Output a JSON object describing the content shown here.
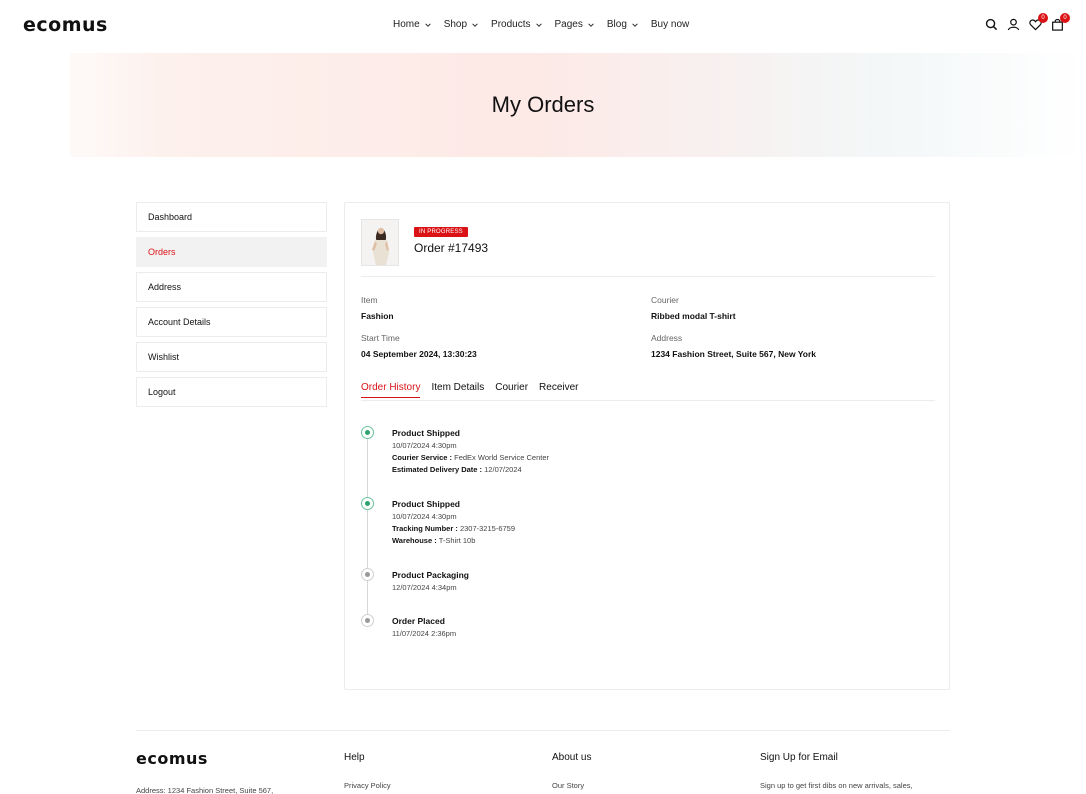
{
  "brand": "ecomus",
  "nav": {
    "items": [
      {
        "label": "Home",
        "has_dropdown": true
      },
      {
        "label": "Shop",
        "has_dropdown": true
      },
      {
        "label": "Products",
        "has_dropdown": true
      },
      {
        "label": "Pages",
        "has_dropdown": true
      },
      {
        "label": "Blog",
        "has_dropdown": true
      },
      {
        "label": "Buy now",
        "has_dropdown": false
      }
    ],
    "icons": [
      "search-icon",
      "user-icon",
      "wishlist-heart-icon",
      "cart-bag-icon"
    ],
    "wishlist_count": "0",
    "cart_count": "0"
  },
  "page": {
    "title": "My Orders"
  },
  "sidebar": {
    "items": [
      {
        "label": "Dashboard",
        "active": false
      },
      {
        "label": "Orders",
        "active": true
      },
      {
        "label": "Address",
        "active": false
      },
      {
        "label": "Account Details",
        "active": false
      },
      {
        "label": "Wishlist",
        "active": false
      },
      {
        "label": "Logout",
        "active": false
      }
    ]
  },
  "order": {
    "status": "IN PROGRESS",
    "number": "Order #17493",
    "item_label": "Item",
    "item_value": "Fashion",
    "courier_label": "Courier",
    "courier_value": "Ribbed modal T-shirt",
    "start_label": "Start Time",
    "start_value": "04 September 2024, 13:30:23",
    "address_label": "Address",
    "address_value": "1234 Fashion Street, Suite 567, New York"
  },
  "tabs": [
    {
      "label": "Order History",
      "active": true
    },
    {
      "label": "Item Details",
      "active": false
    },
    {
      "label": "Courier",
      "active": false
    },
    {
      "label": "Receiver",
      "active": false
    }
  ],
  "timeline": [
    {
      "title": "Product Shipped",
      "time": "10/07/2024 4:30pm",
      "lines": [
        {
          "label": "Courier Service :",
          "value": "FedEx World Service Center"
        },
        {
          "label": "Estimated Delivery Date :",
          "value": "12/07/2024"
        }
      ],
      "done": true
    },
    {
      "title": "Product Shipped",
      "time": "10/07/2024 4:30pm",
      "lines": [
        {
          "label": "Tracking Number :",
          "value": "2307-3215-6759"
        },
        {
          "label": "Warehouse :",
          "value": "T-Shirt 10b"
        }
      ],
      "done": true
    },
    {
      "title": "Product Packaging",
      "time": "12/07/2024 4:34pm",
      "lines": [],
      "done": false
    },
    {
      "title": "Order Placed",
      "time": "11/07/2024 2:36pm",
      "lines": [],
      "done": false
    }
  ],
  "footer": {
    "address": "Address: 1234 Fashion Street, Suite 567,",
    "help_heading": "Help",
    "help_link": "Privacy Policy",
    "about_heading": "About us",
    "about_link": "Our Story",
    "signup_heading": "Sign Up for Email",
    "signup_text": "Sign up to get first dibs on new arrivals, sales,"
  },
  "colors": {
    "accent": "#db1215",
    "timeline_done": "#2fa36b",
    "timeline_pending": "#999999"
  }
}
